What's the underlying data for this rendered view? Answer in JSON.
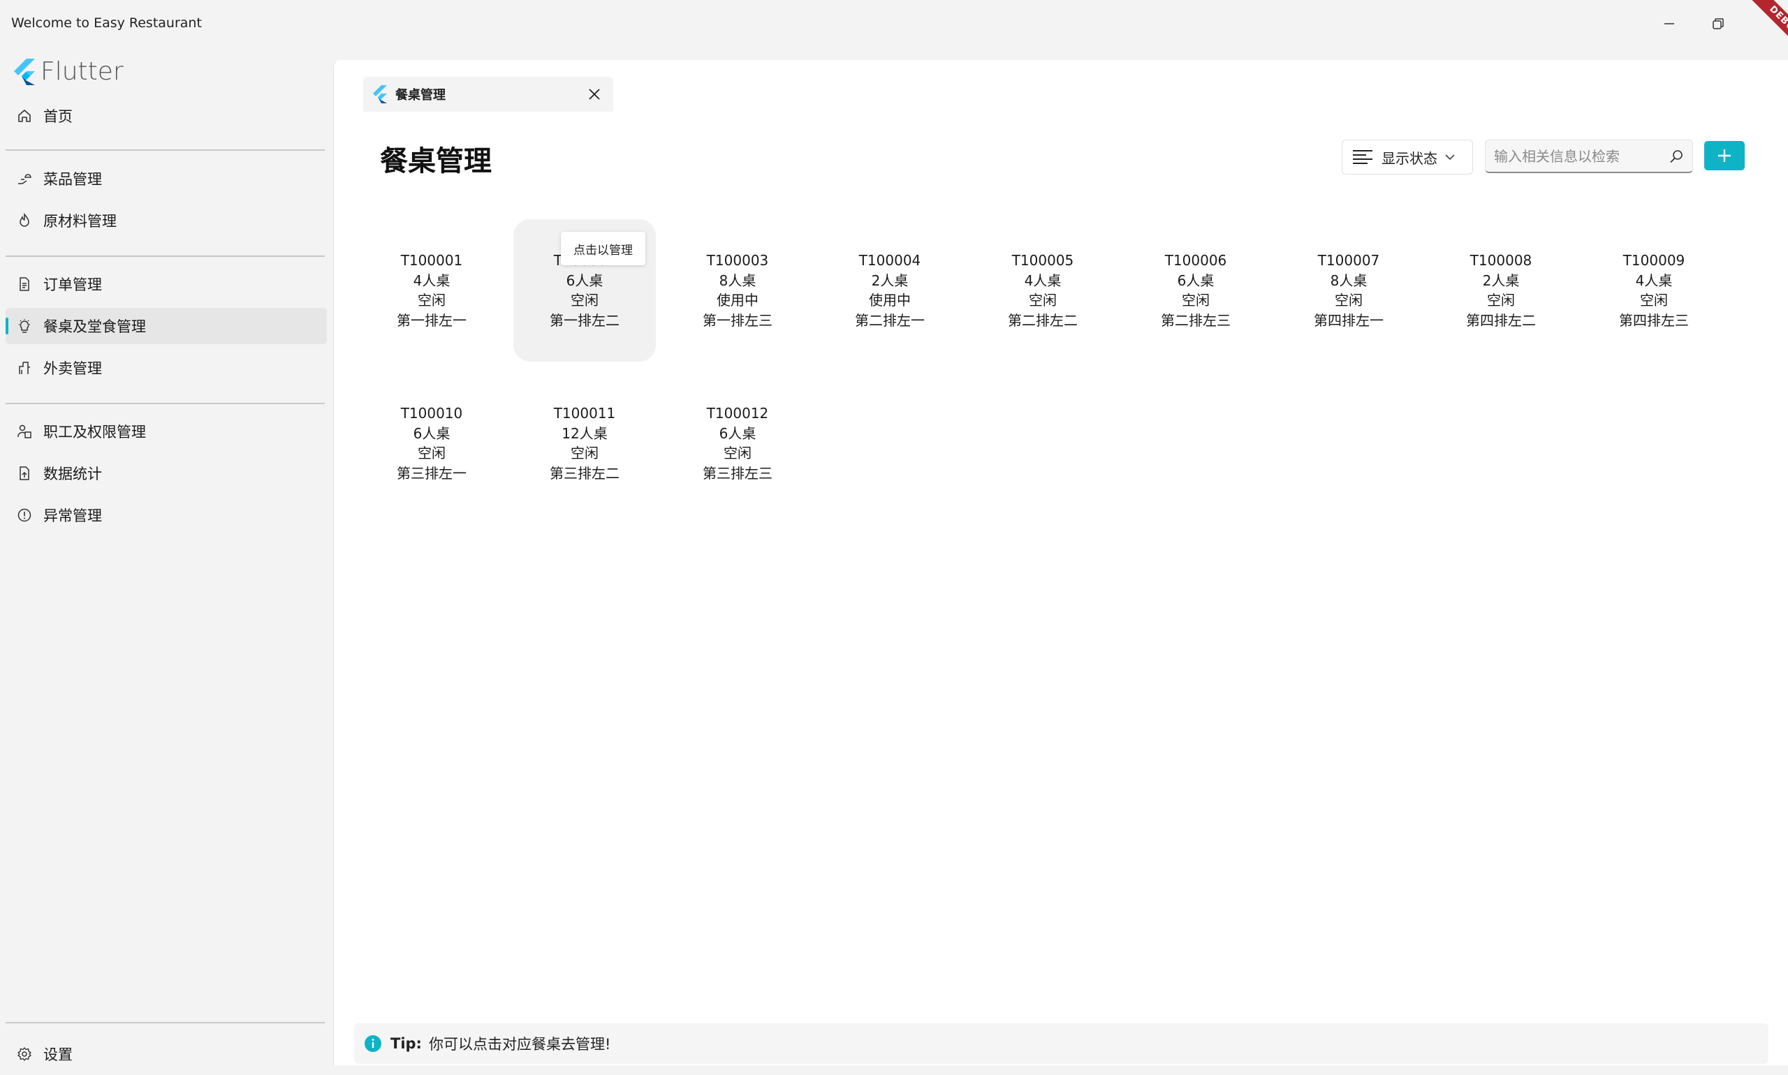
{
  "window": {
    "title": "Welcome to Easy Restaurant",
    "debug_banner": "DEBUG"
  },
  "sidebar": {
    "logo_text": "Flutter",
    "items": [
      {
        "label": "首页",
        "icon": "home-icon"
      },
      {
        "label": "菜品管理",
        "icon": "hand-plate-icon"
      },
      {
        "label": "原材料管理",
        "icon": "flame-icon"
      },
      {
        "label": "订单管理",
        "icon": "order-document-icon"
      },
      {
        "label": "餐桌及堂食管理",
        "icon": "lightbulb-icon",
        "active": true
      },
      {
        "label": "外卖管理",
        "icon": "delivery-icon"
      },
      {
        "label": "职工及权限管理",
        "icon": "people-icon"
      },
      {
        "label": "数据统计",
        "icon": "document-upload-icon"
      },
      {
        "label": "异常管理",
        "icon": "alert-circle-icon"
      }
    ],
    "settings_label": "设置"
  },
  "tab": {
    "label": "餐桌管理"
  },
  "page": {
    "title": "餐桌管理",
    "status_dropdown": "显示状态",
    "search_placeholder": "输入相关信息以检索",
    "accent_color": "#0fb3c6"
  },
  "tables": [
    {
      "id": "T100001",
      "size": "4人桌",
      "status": "空闲",
      "location": "第一排左一"
    },
    {
      "id": "T100002",
      "size": "6人桌",
      "status": "空闲",
      "location": "第一排左二"
    },
    {
      "id": "T100003",
      "size": "8人桌",
      "status": "使用中",
      "location": "第一排左三"
    },
    {
      "id": "T100004",
      "size": "2人桌",
      "status": "使用中",
      "location": "第二排左一"
    },
    {
      "id": "T100005",
      "size": "4人桌",
      "status": "空闲",
      "location": "第二排左二"
    },
    {
      "id": "T100006",
      "size": "6人桌",
      "status": "空闲",
      "location": "第二排左三"
    },
    {
      "id": "T100007",
      "size": "8人桌",
      "status": "空闲",
      "location": "第四排左一"
    },
    {
      "id": "T100008",
      "size": "2人桌",
      "status": "空闲",
      "location": "第四排左二"
    },
    {
      "id": "T100009",
      "size": "4人桌",
      "status": "空闲",
      "location": "第四排左三"
    },
    {
      "id": "T100010",
      "size": "6人桌",
      "status": "空闲",
      "location": "第三排左一"
    },
    {
      "id": "T100011",
      "size": "12人桌",
      "status": "空闲",
      "location": "第三排左二"
    },
    {
      "id": "T100012",
      "size": "6人桌",
      "status": "空闲",
      "location": "第三排左三"
    }
  ],
  "tooltip": "点击以管理",
  "tip": {
    "title": "Tip:",
    "text": "你可以点击对应餐桌去管理!"
  }
}
